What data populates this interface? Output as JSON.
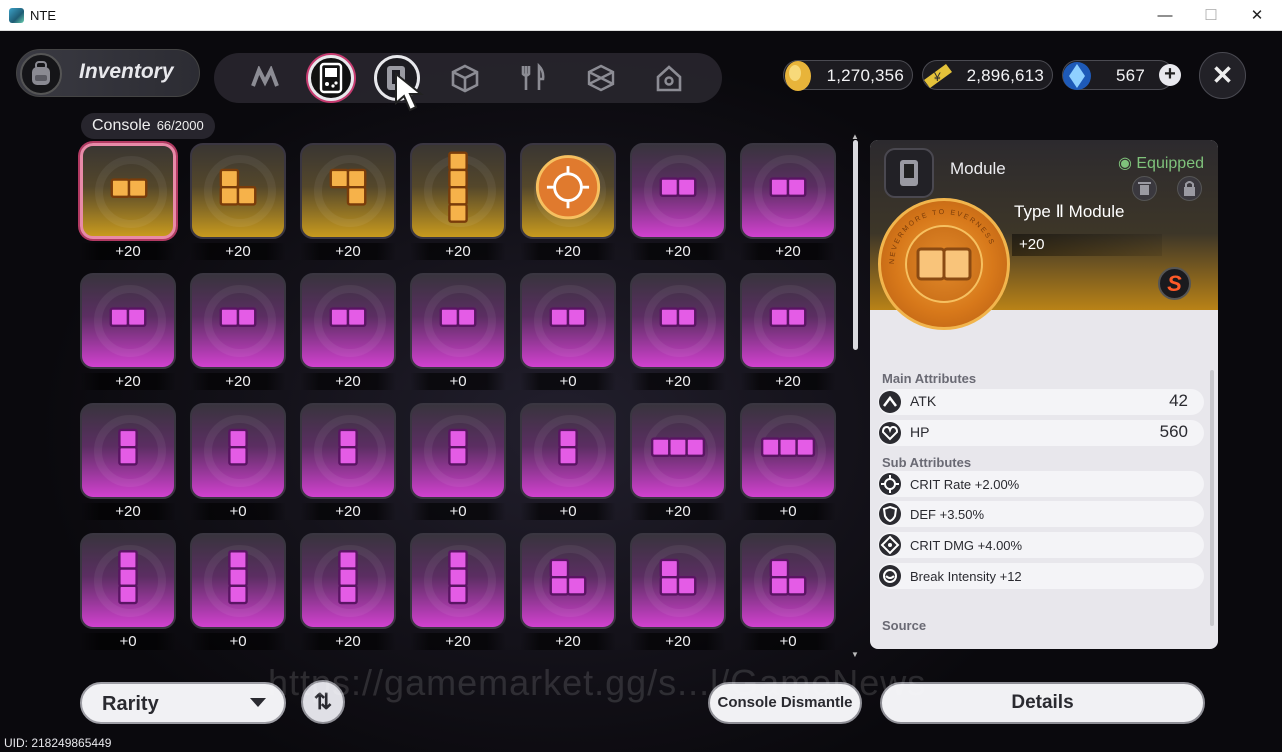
{
  "window": {
    "title": "NTE",
    "minimize": "—",
    "maximize": "☐",
    "close": "✕"
  },
  "header": {
    "title": "Inventory",
    "tabs": [
      {
        "name": "n-logo",
        "active": false
      },
      {
        "name": "console-handheld",
        "active": true
      },
      {
        "name": "console-module",
        "active": false,
        "hover": true
      },
      {
        "name": "cube",
        "active": false
      },
      {
        "name": "food",
        "active": false
      },
      {
        "name": "crate",
        "active": false
      },
      {
        "name": "home",
        "active": false
      }
    ]
  },
  "currencies": [
    {
      "icon": "gold-coin-icon",
      "value": "1,270,356"
    },
    {
      "icon": "ticket-icon",
      "value": "2,896,613"
    },
    {
      "icon": "crystal-icon",
      "value": "567",
      "add": "+"
    }
  ],
  "close_label": "✕",
  "console": {
    "label": "Console",
    "count": "66/2000"
  },
  "items": [
    {
      "rarity": "gold",
      "shape": "h2",
      "level": "+20",
      "selected": true
    },
    {
      "rarity": "gold",
      "shape": "L3",
      "level": "+20"
    },
    {
      "rarity": "gold",
      "shape": "J3",
      "level": "+20"
    },
    {
      "rarity": "gold",
      "shape": "v4",
      "level": "+20"
    },
    {
      "rarity": "gold",
      "shape": "medal",
      "level": "+20"
    },
    {
      "rarity": "purple",
      "shape": "h2",
      "level": "+20"
    },
    {
      "rarity": "purple",
      "shape": "h2",
      "level": "+20"
    },
    {
      "rarity": "purple",
      "shape": "h2",
      "level": "+20"
    },
    {
      "rarity": "purple",
      "shape": "h2",
      "level": "+20"
    },
    {
      "rarity": "purple",
      "shape": "h2",
      "level": "+20"
    },
    {
      "rarity": "purple",
      "shape": "h2",
      "level": "+0"
    },
    {
      "rarity": "purple",
      "shape": "h2",
      "level": "+0"
    },
    {
      "rarity": "purple",
      "shape": "h2",
      "level": "+20"
    },
    {
      "rarity": "purple",
      "shape": "h2",
      "level": "+20"
    },
    {
      "rarity": "purple",
      "shape": "v2",
      "level": "+20"
    },
    {
      "rarity": "purple",
      "shape": "v2",
      "level": "+0"
    },
    {
      "rarity": "purple",
      "shape": "v2",
      "level": "+20"
    },
    {
      "rarity": "purple",
      "shape": "v2",
      "level": "+0"
    },
    {
      "rarity": "purple",
      "shape": "v2",
      "level": "+0"
    },
    {
      "rarity": "purple",
      "shape": "h3",
      "level": "+20"
    },
    {
      "rarity": "purple",
      "shape": "h3",
      "level": "+0"
    },
    {
      "rarity": "purple",
      "shape": "v3",
      "level": "+0"
    },
    {
      "rarity": "purple",
      "shape": "v3",
      "level": "+0"
    },
    {
      "rarity": "purple",
      "shape": "v3",
      "level": "+20"
    },
    {
      "rarity": "purple",
      "shape": "v3",
      "level": "+20"
    },
    {
      "rarity": "purple",
      "shape": "L3b",
      "level": "+20"
    },
    {
      "rarity": "purple",
      "shape": "L3b",
      "level": "+20"
    },
    {
      "rarity": "purple",
      "shape": "L3b",
      "level": "+0"
    }
  ],
  "detail": {
    "category": "Module",
    "status": "Equipped",
    "name": "Type Ⅱ Module",
    "level": "+20",
    "badge": "S",
    "medal_text": "NEVERMORE TO EVERNESS",
    "main_title": "Main Attributes",
    "main": [
      {
        "name": "ATK",
        "value": "42",
        "icon": "atk-icon"
      },
      {
        "name": "HP",
        "value": "560",
        "icon": "hp-icon"
      }
    ],
    "sub_title": "Sub Attributes",
    "sub": [
      {
        "text": "CRIT Rate +2.00%",
        "icon": "crit-rate-icon"
      },
      {
        "text": "DEF +3.50%",
        "icon": "def-icon"
      },
      {
        "text": "CRIT DMG +4.00%",
        "icon": "crit-dmg-icon"
      },
      {
        "text": "Break Intensity +12",
        "icon": "break-icon"
      }
    ],
    "source_title": "Source"
  },
  "bottom": {
    "rarity": "Rarity",
    "sort": "⇅",
    "dismantle": "Console Dismantle",
    "details": "Details"
  },
  "watermark": "https://gamemarket.gg/s...l/GameNews",
  "uid": "UID: 218249865449",
  "colors": {
    "gold": "#c89a1e",
    "purple": "#d141cf",
    "piece_gold": "#f6b24a",
    "piece_purple": "#e45ce6",
    "equipped": "#7fc27b"
  }
}
